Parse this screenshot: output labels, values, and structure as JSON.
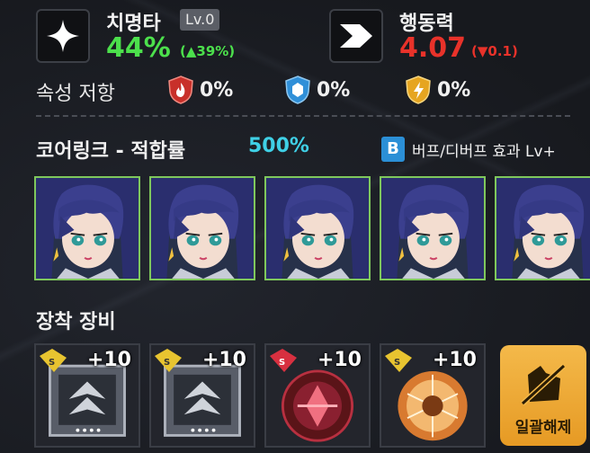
{
  "stats": {
    "crit": {
      "name": "치명타",
      "level": "Lv.0",
      "value": "44%",
      "delta": "(▲39%)",
      "color": "#4ce04c",
      "icon": "sparkle-icon"
    },
    "action": {
      "name": "행동력",
      "value": "4.07",
      "delta": "(▼0.1)",
      "color": "#e8322a",
      "icon": "chevron-right-icon"
    }
  },
  "resist": {
    "label": "속성 저항",
    "items": [
      {
        "element": "fire",
        "icon": "fire-shield-icon",
        "value": "0%",
        "color": "#c8302a"
      },
      {
        "element": "water",
        "icon": "water-shield-icon",
        "value": "0%",
        "color": "#2f8fd8"
      },
      {
        "element": "electric",
        "icon": "lightning-shield-icon",
        "value": "0%",
        "color": "#e6a520"
      }
    ]
  },
  "core_link": {
    "title": "코어링크 - 적합률",
    "rate": "500%",
    "badge": "B",
    "buff_text": "버프/디버프 효과 Lv+",
    "rate_color": "#3fd0e6",
    "frame_color": "#7fc85c"
  },
  "equipment": {
    "title": "장착 장비",
    "items": [
      {
        "enhance": "+10",
        "type": "chip-gray"
      },
      {
        "enhance": "+10",
        "type": "chip-gray"
      },
      {
        "enhance": "+10",
        "type": "sphere-red"
      },
      {
        "enhance": "+10",
        "type": "orb-gold"
      }
    ],
    "release_label": "일괄해제",
    "release_icon": "unequip-icon"
  }
}
